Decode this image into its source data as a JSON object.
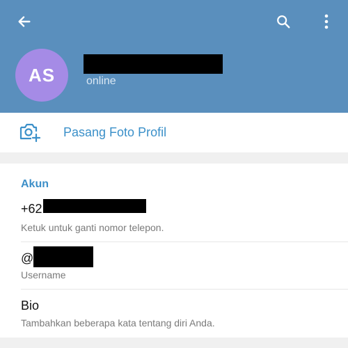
{
  "header": {
    "avatar_initials": "AS",
    "status": "online",
    "colors": {
      "header_bg": "#5a8fbd",
      "avatar_bg": "#a58be6"
    },
    "icons": {
      "back": "arrow-left-icon",
      "search": "search-icon",
      "more": "more-vertical-icon"
    }
  },
  "photo_row": {
    "label": "Pasang Foto Profil",
    "icon": "camera-plus-icon"
  },
  "account": {
    "title": "Akun",
    "phone": {
      "prefix": "+62",
      "hint": "Ketuk untuk ganti nomor telepon."
    },
    "username": {
      "prefix": "@",
      "hint": "Username"
    },
    "bio": {
      "label": "Bio",
      "hint": "Tambahkan beberapa kata tentang diri Anda."
    }
  }
}
